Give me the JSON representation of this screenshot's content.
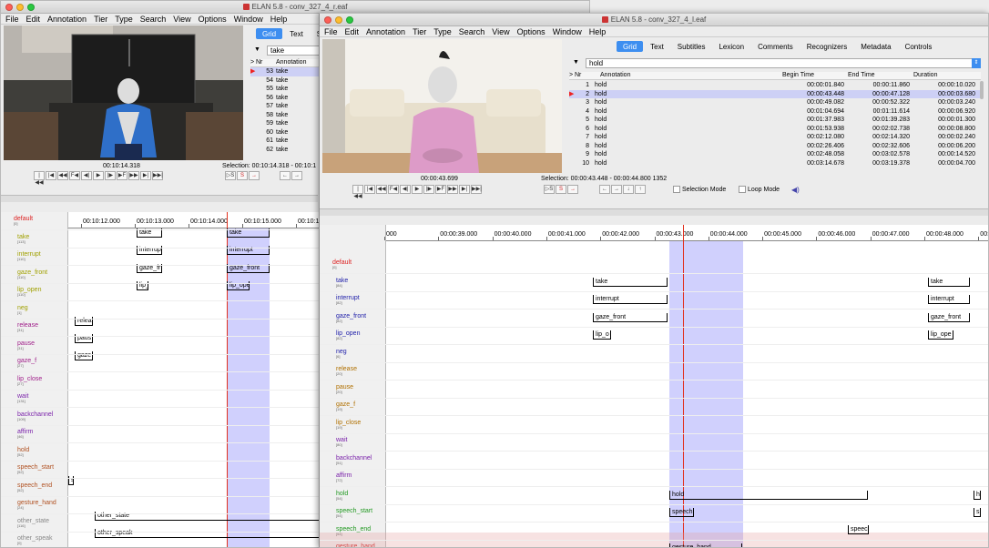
{
  "left": {
    "title": "ELAN 5.8 - conv_327_4_r.eaf",
    "menu": [
      "File",
      "Edit",
      "Annotation",
      "Tier",
      "Type",
      "Search",
      "View",
      "Options",
      "Window",
      "Help"
    ],
    "timecode": "00:10:14.318",
    "selection": "Selection: 00:10:14.318 - 00:10:1",
    "tabs": [
      "Grid",
      "Text",
      "S"
    ],
    "combo": "take",
    "grid_head": [
      ">",
      "Nr",
      "Annotation"
    ],
    "grid_rows": [
      [
        "53",
        "take"
      ],
      [
        "54",
        "take"
      ],
      [
        "55",
        "take"
      ],
      [
        "56",
        "take"
      ],
      [
        "57",
        "take"
      ],
      [
        "58",
        "take"
      ],
      [
        "59",
        "take"
      ],
      [
        "60",
        "take"
      ],
      [
        "61",
        "take"
      ],
      [
        "62",
        "take"
      ]
    ],
    "ruler": [
      "00:10:12.000",
      "00:10:13.000",
      "00:10:14.000",
      "00:10:15.000",
      "00:10:1"
    ],
    "tiers": [
      {
        "name": "default",
        "count": "[0]",
        "color": "#d22"
      },
      {
        "name": "take",
        "count": "[113]",
        "color": "#a0a000"
      },
      {
        "name": "interrupt",
        "count": "[110]",
        "color": "#a0a000"
      },
      {
        "name": "gaze_front",
        "count": "[110]",
        "color": "#a0a000"
      },
      {
        "name": "lip_open",
        "count": "[110]",
        "color": "#a0a000"
      },
      {
        "name": "neg",
        "count": "[1]",
        "color": "#a0a000"
      },
      {
        "name": "release",
        "count": "[31]",
        "color": "#a0208a"
      },
      {
        "name": "pause",
        "count": "[31]",
        "color": "#a0208a"
      },
      {
        "name": "gaze_f",
        "count": "[27]",
        "color": "#a0208a"
      },
      {
        "name": "lip_close",
        "count": "[27]",
        "color": "#a0208a"
      },
      {
        "name": "wait",
        "count": "[131]",
        "color": "#7a22aa"
      },
      {
        "name": "backchannel",
        "count": "[109]",
        "color": "#7a22aa"
      },
      {
        "name": "affirm",
        "count": "[46]",
        "color": "#7a22aa"
      },
      {
        "name": "hold",
        "count": "[52]",
        "color": "#b05020"
      },
      {
        "name": "speech_start",
        "count": "[52]",
        "color": "#b05020"
      },
      {
        "name": "speech_end",
        "count": "[52]",
        "color": "#b05020"
      },
      {
        "name": "gesture_hand",
        "count": "[24]",
        "color": "#b05020"
      },
      {
        "name": "other_state",
        "count": "[116]",
        "color": "#888"
      },
      {
        "name": "other_speak",
        "count": "[0]",
        "color": "#888"
      }
    ],
    "anns": {
      "take1": "take",
      "take2": "take",
      "int1": "interrup",
      "int2": "interrupt",
      "gf1": "gaze_fr",
      "gf2": "gaze_front",
      "lo1": "lip_",
      "lo2": "lip_ope",
      "rel": "relea",
      "pau": "paus",
      "gz": "gaze",
      "sp": "sp",
      "os": "other_state",
      "osp": "other_speak"
    }
  },
  "right": {
    "title": "ELAN 5.8 - conv_327_4_l.eaf",
    "menu": [
      "File",
      "Edit",
      "Annotation",
      "Tier",
      "Type",
      "Search",
      "View",
      "Options",
      "Window",
      "Help"
    ],
    "timecode": "00:00:43.699",
    "selection": "Selection: 00:00:43.448 - 00:00:44.800  1352",
    "selection_mode": "Selection Mode",
    "loop_mode": "Loop Mode",
    "tabs": [
      "Grid",
      "Text",
      "Subtitles",
      "Lexicon",
      "Comments",
      "Recognizers",
      "Metadata",
      "Controls"
    ],
    "combo": "hold",
    "grid_head": [
      ">",
      "Nr",
      "Annotation",
      "Begin Time",
      "End Time",
      "Duration"
    ],
    "grid_rows": [
      [
        "1",
        "hold",
        "00:00:01.840",
        "00:00:11.860",
        "00:00:10.020"
      ],
      [
        "2",
        "hold",
        "00:00:43.448",
        "00:00:47.128",
        "00:00:03.680"
      ],
      [
        "3",
        "hold",
        "00:00:49.082",
        "00:00:52.322",
        "00:00:03.240"
      ],
      [
        "4",
        "hold",
        "00:01:04.694",
        "00:01:11.614",
        "00:00:06.920"
      ],
      [
        "5",
        "hold",
        "00:01:37.983",
        "00:01:39.283",
        "00:00:01.300"
      ],
      [
        "6",
        "hold",
        "00:01:53.938",
        "00:02:02.738",
        "00:00:08.800"
      ],
      [
        "7",
        "hold",
        "00:02:12.080",
        "00:02:14.320",
        "00:00:02.240"
      ],
      [
        "8",
        "hold",
        "00:02:26.406",
        "00:02:32.606",
        "00:00:06.200"
      ],
      [
        "9",
        "hold",
        "00:02:48.058",
        "00:03:02.578",
        "00:00:14.520"
      ],
      [
        "10",
        "hold",
        "00:03:14.678",
        "00:03:19.378",
        "00:00:04.700"
      ]
    ],
    "ruler": [
      "000",
      "00:00:39.000",
      "00:00:40.000",
      "00:00:41.000",
      "00:00:42.000",
      "00:00:43.000",
      "00:00:44.000",
      "00:00:45.000",
      "00:00:46.000",
      "00:00:47.000",
      "00:00:48.000",
      "00:00:49.0"
    ],
    "tiers": [
      {
        "name": "default",
        "count": "[0]",
        "color": "#d22"
      },
      {
        "name": "take",
        "count": "[84]",
        "color": "#2222aa"
      },
      {
        "name": "interrupt",
        "count": "[82]",
        "color": "#2222aa"
      },
      {
        "name": "gaze_front",
        "count": "[82]",
        "color": "#2222aa"
      },
      {
        "name": "lip_open",
        "count": "[82]",
        "color": "#2222aa"
      },
      {
        "name": "neg",
        "count": "[6]",
        "color": "#2222aa"
      },
      {
        "name": "release",
        "count": "[20]",
        "color": "#b07000"
      },
      {
        "name": "pause",
        "count": "[20]",
        "color": "#b07000"
      },
      {
        "name": "gaze_f",
        "count": "[19]",
        "color": "#b07000"
      },
      {
        "name": "lip_close",
        "count": "[19]",
        "color": "#b07000"
      },
      {
        "name": "wait",
        "count": "[80]",
        "color": "#7a22aa"
      },
      {
        "name": "backchannel",
        "count": "[51]",
        "color": "#7a22aa"
      },
      {
        "name": "affirm",
        "count": "[72]",
        "color": "#7a22aa"
      },
      {
        "name": "hold",
        "count": "[54]",
        "color": "#229922"
      },
      {
        "name": "speech_start",
        "count": "[54]",
        "color": "#229922"
      },
      {
        "name": "speech_end",
        "count": "[54]",
        "color": "#229922"
      },
      {
        "name": "gesture_hand",
        "count": "[14]",
        "color": "#cc2222"
      }
    ],
    "anns": {
      "take1": "take",
      "take2": "take",
      "int1": "interrupt",
      "int2": "interrupt",
      "gf1": "gaze_front",
      "gf2": "gaze_front",
      "lo1": "lip_o",
      "lo2": "lip_ope",
      "hold": "hold",
      "h2": "h",
      "ss": "speech",
      "ss2": "s",
      "se": "speec",
      "gh": "gesture_hand"
    }
  }
}
